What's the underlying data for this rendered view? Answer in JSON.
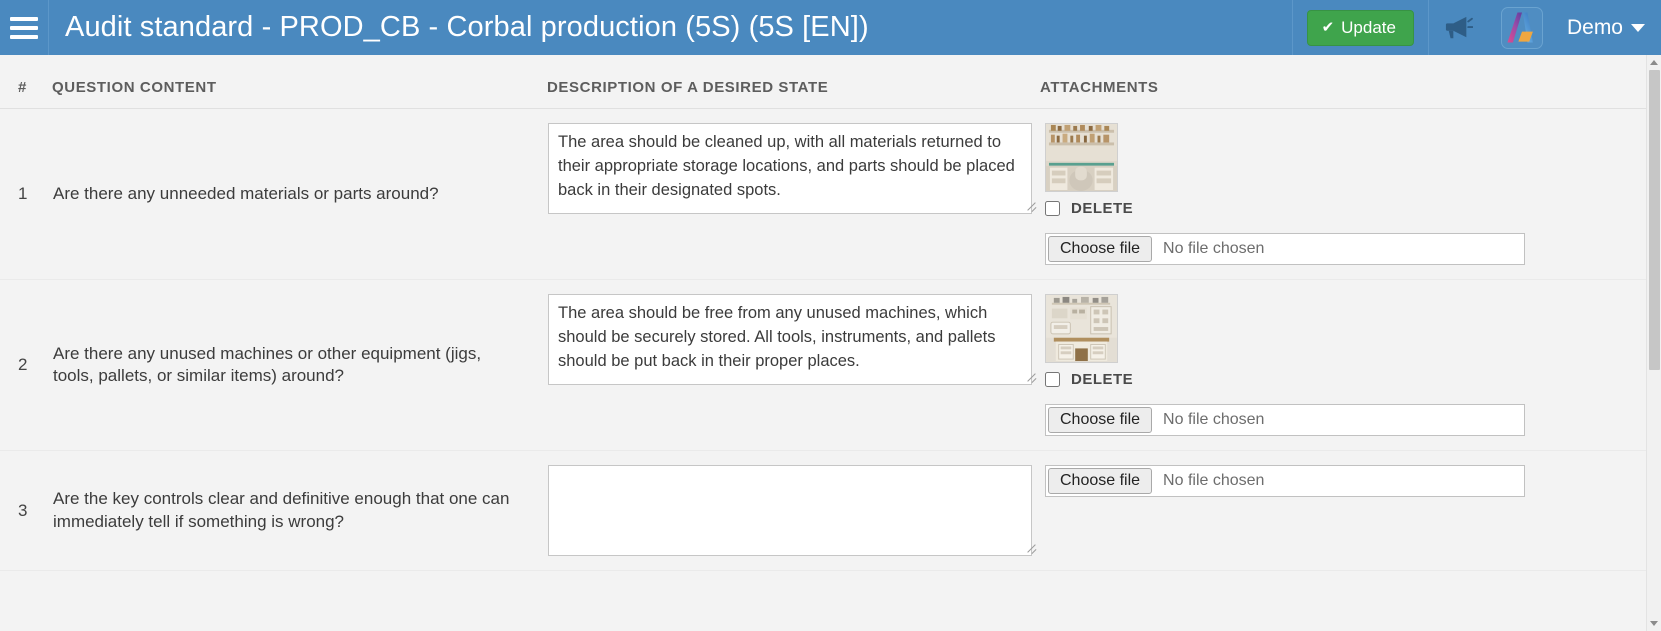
{
  "header": {
    "menu_icon": "hamburger-icon",
    "title": "Audit standard - PROD_CB - Corbal production (5S) (5S [EN])",
    "update_label": "Update",
    "update_check_glyph": "✔",
    "announce_icon": "megaphone-icon",
    "brand_icon": "brand-a-logo-icon",
    "user_label": "Demo",
    "caret_icon": "chevron-down-icon",
    "colors": {
      "topbar_bg": "#4a89bf",
      "update_bg": "#3fa44c",
      "page_bg": "#f3f3f3"
    }
  },
  "table": {
    "columns": {
      "number": "#",
      "question": "QUESTION CONTENT",
      "description": "DESCRIPTION OF A DESIRED STATE",
      "attachments": "ATTACHMENTS"
    },
    "file_input": {
      "button_label": "Choose file",
      "status_text": "No file chosen"
    },
    "delete_label": "DELETE",
    "rows": [
      {
        "number": "1",
        "question": "Are there any unneeded materials or parts around?",
        "description": "The area should be cleaned up, with all materials returned to their appropriate storage locations, and parts should be placed back in their designated spots.",
        "description_scrollable": true,
        "has_attachment": true,
        "attachment_alt": "workshop-shelving-thumbnail"
      },
      {
        "number": "2",
        "question": "Are there any unused machines or other equipment (jigs, tools, pallets, or similar items) around?",
        "description": "The area should be free from any unused machines, which should be securely stored. All tools, instruments, and pallets should be put back in their proper places.",
        "description_scrollable": false,
        "has_attachment": true,
        "attachment_alt": "workshop-workbench-thumbnail"
      },
      {
        "number": "3",
        "question": "Are the key controls clear and definitive enough that one can immediately tell if something is wrong?",
        "description": "",
        "description_scrollable": false,
        "has_attachment": false,
        "attachment_alt": ""
      }
    ]
  }
}
